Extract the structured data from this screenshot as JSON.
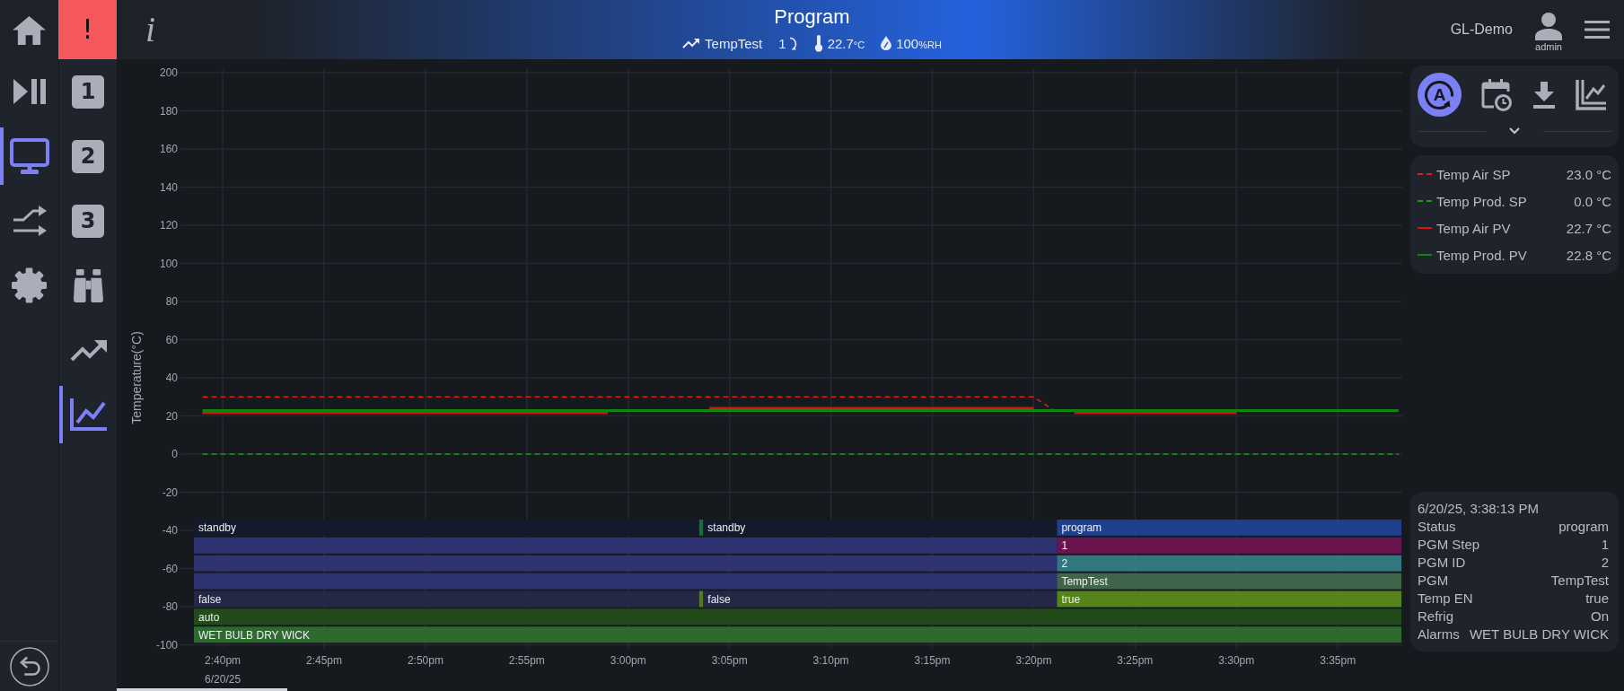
{
  "header": {
    "alert_glyph": "!",
    "info_glyph": "i",
    "title": "Program",
    "program": "TempTest",
    "step": "1",
    "temperature": "22.7",
    "temperature_unit": "°C",
    "humidity": "100",
    "humidity_unit": "%RH",
    "site": "GL-Demo",
    "user": "admin"
  },
  "nav": {
    "items": [
      {
        "selected": false
      },
      {
        "selected": true
      },
      {
        "selected": false
      },
      {
        "selected": false
      }
    ]
  },
  "subnav": {
    "items": [
      {
        "kind": "badge",
        "label": "1",
        "selected": false
      },
      {
        "kind": "badge",
        "label": "2",
        "selected": false
      },
      {
        "kind": "badge",
        "label": "3",
        "selected": false
      },
      {
        "kind": "icon",
        "selected": false
      },
      {
        "kind": "icon",
        "selected": false
      },
      {
        "kind": "icon",
        "selected": true
      }
    ]
  },
  "chart": {
    "date_label": "6/20/25",
    "chart_data": {
      "type": "line",
      "ylabel": "Temperature(°C)",
      "grid": true,
      "categories": [
        null,
        "2:40pm",
        null,
        null,
        null,
        null,
        "2:45pm",
        null,
        null,
        null,
        null,
        "2:50pm",
        null,
        null,
        null,
        null,
        "2:55pm",
        null,
        null,
        null,
        null,
        "3:00pm",
        null,
        null,
        null,
        null,
        "3:05pm",
        null,
        null,
        null,
        null,
        "3:10pm",
        null,
        null,
        null,
        null,
        "3:15pm",
        null,
        null,
        null,
        null,
        "3:20pm",
        null,
        null,
        null,
        null,
        "3:25pm",
        null,
        null,
        null,
        null,
        "3:30pm",
        null,
        null,
        null,
        null,
        "3:35pm",
        null,
        null,
        null
      ],
      "series": [
        {
          "name": "Temp Air SP",
          "color": "#e31b1b",
          "line_style": "dashed",
          "values": [
            30,
            30,
            30,
            30,
            30,
            30,
            30,
            30,
            30,
            30,
            30,
            30,
            30,
            30,
            30,
            30,
            30,
            30,
            30,
            30,
            30,
            30,
            30,
            30,
            30,
            30,
            30,
            30,
            30,
            30,
            30,
            30,
            30,
            30,
            30,
            30,
            30,
            30,
            30,
            30,
            30,
            30,
            23,
            null,
            null,
            null,
            null,
            null,
            null,
            null,
            null,
            null,
            null,
            null,
            null,
            null,
            null,
            null,
            null,
            null
          ]
        },
        {
          "name": "Temp Prod. SP",
          "color": "#1a9a1a",
          "line_style": "dashed",
          "values": [
            0,
            0,
            0,
            0,
            0,
            0,
            0,
            0,
            0,
            0,
            0,
            0,
            0,
            0,
            0,
            0,
            0,
            0,
            0,
            0,
            0,
            0,
            0,
            0,
            0,
            0,
            0,
            0,
            0,
            0,
            0,
            0,
            0,
            0,
            0,
            0,
            0,
            0,
            0,
            0,
            0,
            0,
            0,
            0,
            0,
            0,
            0,
            0,
            0,
            0,
            0,
            0,
            0,
            0,
            0,
            0,
            0,
            0,
            0,
            0
          ]
        },
        {
          "name": "Temp Air PV",
          "color": "#d41414",
          "line_style": "solid",
          "values": [
            21.6,
            21.6,
            21.6,
            21.6,
            21.6,
            21.6,
            21.6,
            21.6,
            21.6,
            21.6,
            21.6,
            21.6,
            21.6,
            21.6,
            21.6,
            21.6,
            21.6,
            21.6,
            21.6,
            21.6,
            21.6,
            null,
            null,
            null,
            null,
            24,
            24,
            24,
            24,
            24,
            24,
            24,
            24,
            24,
            24,
            24,
            24,
            24,
            24,
            24,
            24,
            24,
            null,
            21.6,
            21.6,
            21.6,
            21.6,
            21.6,
            21.6,
            21.6,
            21.6,
            21.6,
            null,
            null,
            null,
            null,
            null,
            null,
            null,
            null
          ]
        },
        {
          "name": "Temp Prod. PV",
          "color": "#0e870e",
          "line_style": "solid",
          "values": [
            22.8,
            22.8,
            22.8,
            22.8,
            22.8,
            22.8,
            22.8,
            22.8,
            22.8,
            22.8,
            22.8,
            22.8,
            22.8,
            22.8,
            22.8,
            22.8,
            22.8,
            22.8,
            22.8,
            22.8,
            22.8,
            22.8,
            22.8,
            22.8,
            22.8,
            22.8,
            22.8,
            22.8,
            22.8,
            22.8,
            22.8,
            22.8,
            22.8,
            22.8,
            22.8,
            22.8,
            22.8,
            22.8,
            22.8,
            22.8,
            22.8,
            22.8,
            22.8,
            22.8,
            22.8,
            22.8,
            22.8,
            22.8,
            22.8,
            22.8,
            22.8,
            22.8,
            22.8,
            22.8,
            22.8,
            22.8,
            22.8,
            22.8,
            22.8,
            22.8
          ]
        }
      ],
      "ylim": [
        -100,
        200
      ],
      "yticks": [
        200,
        180,
        160,
        140,
        120,
        100,
        80,
        60,
        40,
        20,
        0,
        -20,
        -40,
        -60,
        -80,
        -100
      ]
    },
    "timeline": [
      {
        "segments": [
          {
            "label": "standby",
            "color": "#121a2c"
          },
          {
            "color": "#1d6a3d"
          },
          {
            "label": "standby",
            "color": "#121a2c"
          },
          {
            "label": "program",
            "color": "#1f3f8c"
          }
        ]
      },
      {
        "segments": [
          {
            "color": "#2e3372"
          },
          {
            "label": "1",
            "color": "#6a1550"
          }
        ]
      },
      {
        "segments": [
          {
            "color": "#2e3372"
          },
          {
            "label": "2",
            "color": "#33777f"
          }
        ]
      },
      {
        "segments": [
          {
            "color": "#2e3372"
          },
          {
            "label": "TempTest",
            "color": "#41654b"
          }
        ]
      },
      {
        "segments": [
          {
            "label": "false",
            "color": "#232847"
          },
          {
            "color": "#4f7d1a"
          },
          {
            "label": "false",
            "color": "#232847"
          },
          {
            "label": "true",
            "color": "#54841a"
          }
        ]
      },
      {
        "segments": [
          {
            "label": "auto",
            "color": "#214c1a"
          }
        ]
      },
      {
        "segments": [
          {
            "label": "WET BULB DRY WICK",
            "color": "#2e6a2f"
          }
        ]
      }
    ]
  },
  "toolbar": {
    "items": [
      {
        "label": "A",
        "selected": true
      },
      {
        "selected": false
      },
      {
        "selected": false
      },
      {
        "selected": false
      }
    ]
  },
  "legend": [
    {
      "value": "23.0 °C"
    },
    {
      "value": "0.0 °C"
    },
    {
      "value": "22.7 °C"
    },
    {
      "value": "22.8 °C"
    }
  ],
  "info": {
    "timestamp": "6/20/25, 3:38:13 PM",
    "rows": [
      {
        "label": "Status",
        "value": "program"
      },
      {
        "label": "PGM Step",
        "value": "1"
      },
      {
        "label": "PGM ID",
        "value": "2"
      },
      {
        "label": "PGM",
        "value": "TempTest"
      },
      {
        "label": "Temp EN",
        "value": "true"
      },
      {
        "label": "Refrig",
        "value": "On"
      },
      {
        "label": "Alarms",
        "value": "WET BULB DRY WICK"
      }
    ]
  }
}
